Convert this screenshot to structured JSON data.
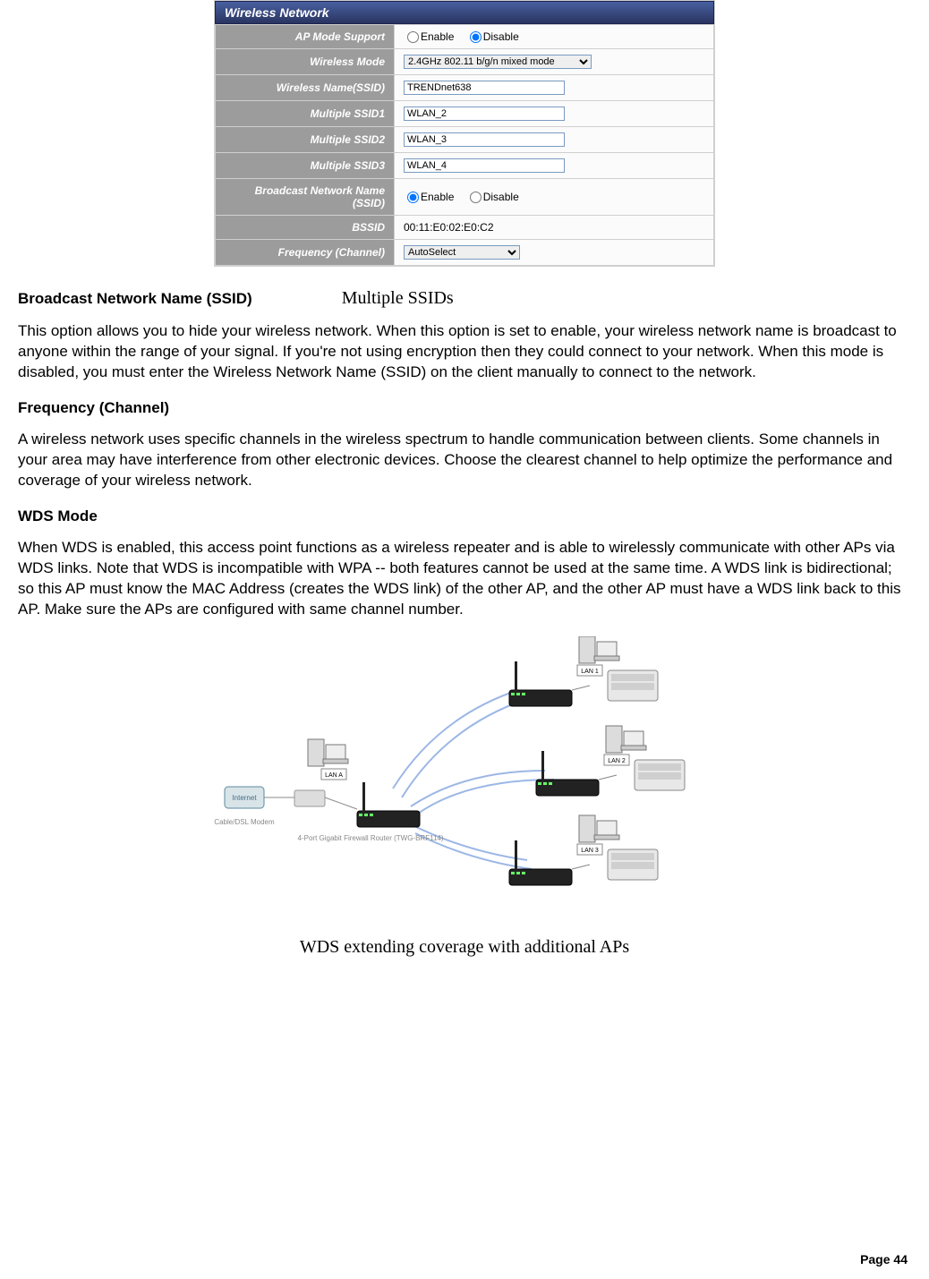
{
  "panel": {
    "title": "Wireless Network",
    "rows": {
      "ap_mode_label": "AP Mode Support",
      "ap_mode_enable": "Enable",
      "ap_mode_disable": "Disable",
      "wl_mode_label": "Wireless Mode",
      "wl_mode_value": "2.4GHz 802.11 b/g/n mixed mode",
      "ssid_label": "Wireless Name(SSID)",
      "ssid_value": "TRENDnet638",
      "mssid1_label": "Multiple SSID1",
      "mssid1_value": "WLAN_2",
      "mssid2_label": "Multiple SSID2",
      "mssid2_value": "WLAN_3",
      "mssid3_label": "Multiple SSID3",
      "mssid3_value": "WLAN_4",
      "bcast_label": "Broadcast Network Name (SSID)",
      "bcast_enable": "Enable",
      "bcast_disable": "Disable",
      "bssid_label": "BSSID",
      "bssid_value": "00:11:E0:02:E0:C2",
      "freq_label": "Frequency (Channel)",
      "freq_value": "AutoSelect"
    }
  },
  "headings": {
    "broadcast": "Broadcast Network Name (SSID)",
    "multiple_ssids": "Multiple SSIDs",
    "frequency": "Frequency (Channel)",
    "wds": "WDS Mode"
  },
  "paragraphs": {
    "broadcast": "This option allows you to hide your wireless network. When this option is set to enable, your wireless network name is broadcast to anyone within the range of your signal. If you're not using encryption then they could connect to your network. When this mode is disabled, you must enter the Wireless Network Name (SSID) on the client manually to connect to the network.",
    "frequency": "A wireless network uses specific channels in the wireless spectrum to handle communication between clients. Some channels in your area may have interference from other electronic devices. Choose the clearest channel to help optimize the performance and coverage of your wireless network.",
    "wds": "When WDS is enabled, this access point functions as a wireless repeater and is able to wirelessly communicate with other APs via WDS links. Note that WDS is incompatible with WPA -- both features cannot be used at the same time. A WDS link is bidirectional; so this AP must know the MAC Address (creates the WDS link) of the other AP, and the other AP must have a WDS link back to this AP. Make sure the APs are configured with same channel number."
  },
  "diagram": {
    "internet": "Internet",
    "modem": "Cable/DSL Modem",
    "lan_a": "LAN A",
    "router_line": "4-Port Gigabit Firewall Router (TWG-BRF114)",
    "lan1": "LAN 1",
    "lan2": "LAN 2",
    "lan3": "LAN 3",
    "caption": "WDS extending coverage with additional APs"
  },
  "footer": {
    "page_word": "Page",
    "page_num": "44"
  }
}
